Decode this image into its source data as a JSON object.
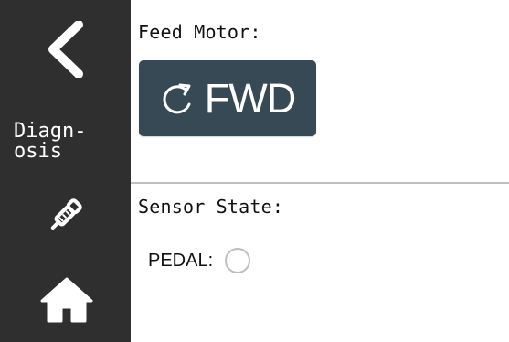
{
  "sidebar": {
    "title": "Diagn-\nosis",
    "icons": {
      "back": "chevron-left-icon",
      "tool": "probe-icon",
      "home": "home-icon"
    }
  },
  "feed_motor": {
    "label": "Feed Motor:",
    "button_label": "FWD",
    "button_icon": "rotate-clockwise-icon"
  },
  "sensor_state": {
    "label": "Sensor State:",
    "pedal_label": "PEDAL:",
    "pedal_state": "off"
  },
  "colors": {
    "sidebar": "#2f2f2f",
    "button": "#374955",
    "text": "#111111",
    "indicator_border": "#bdbdbd"
  }
}
